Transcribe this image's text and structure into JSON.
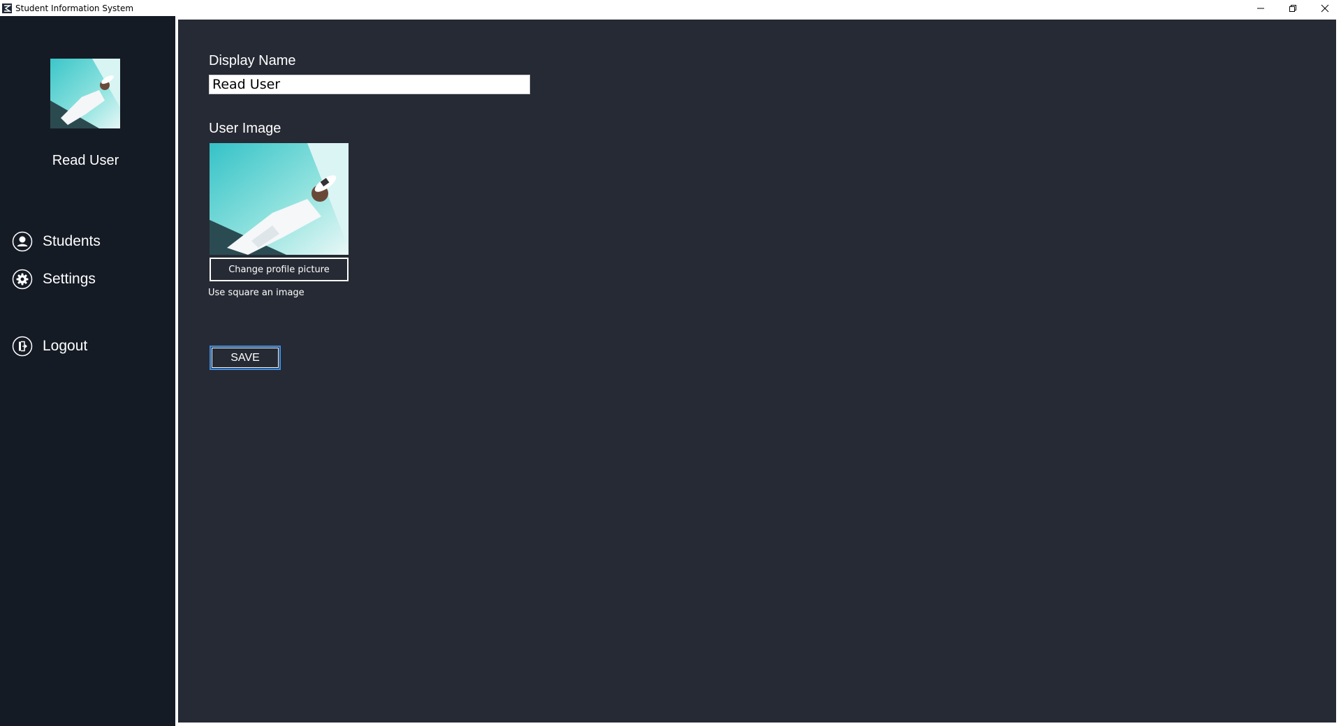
{
  "window": {
    "title": "Student Information System"
  },
  "sidebar": {
    "username": "Read User",
    "items": [
      {
        "label": "Students",
        "icon": "user-icon"
      },
      {
        "label": "Settings",
        "icon": "gear-icon"
      },
      {
        "label": "Logout",
        "icon": "logout-icon"
      }
    ]
  },
  "form": {
    "display_name_label": "Display Name",
    "display_name_value": "Read User",
    "user_image_label": "User Image",
    "change_picture_label": "Change profile picture",
    "hint": "Use square an image",
    "save_label": "SAVE"
  },
  "colors": {
    "sidebar_bg": "#151b25",
    "main_bg": "#262a34",
    "save_focus": "#3b8ee8"
  }
}
